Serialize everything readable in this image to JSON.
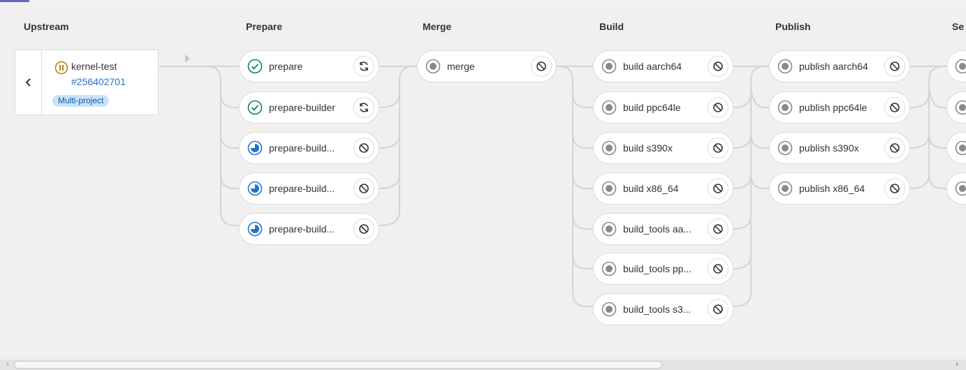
{
  "pipeline": {
    "stages": {
      "upstream": "Upstream",
      "prepare": "Prepare",
      "merge": "Merge",
      "build": "Build",
      "publish": "Publish",
      "next": "Se"
    },
    "upstream_card": {
      "project": "kernel-test",
      "pipeline_id": "#256402701",
      "badge": "Multi-project",
      "status": "paused"
    },
    "prepare_jobs": [
      {
        "name": "prepare",
        "status": "success",
        "action": "retry"
      },
      {
        "name": "prepare-builder",
        "status": "success",
        "action": "retry"
      },
      {
        "name": "prepare-build...",
        "status": "running",
        "action": "cancel"
      },
      {
        "name": "prepare-build...",
        "status": "running",
        "action": "cancel"
      },
      {
        "name": "prepare-build...",
        "status": "running",
        "action": "cancel"
      }
    ],
    "merge_jobs": [
      {
        "name": "merge",
        "status": "created",
        "action": "cancel"
      }
    ],
    "build_jobs": [
      {
        "name": "build aarch64",
        "status": "created",
        "action": "cancel"
      },
      {
        "name": "build ppc64le",
        "status": "created",
        "action": "cancel"
      },
      {
        "name": "build s390x",
        "status": "created",
        "action": "cancel"
      },
      {
        "name": "build x86_64",
        "status": "created",
        "action": "cancel"
      },
      {
        "name": "build_tools aa...",
        "status": "created",
        "action": "cancel"
      },
      {
        "name": "build_tools pp...",
        "status": "created",
        "action": "cancel"
      },
      {
        "name": "build_tools s3...",
        "status": "created",
        "action": "cancel"
      }
    ],
    "publish_jobs": [
      {
        "name": "publish aarch64",
        "status": "created",
        "action": "cancel"
      },
      {
        "name": "publish ppc64le",
        "status": "created",
        "action": "cancel"
      },
      {
        "name": "publish s390x",
        "status": "created",
        "action": "cancel"
      },
      {
        "name": "publish x86_64",
        "status": "created",
        "action": "cancel"
      }
    ]
  },
  "colors": {
    "success": "#108548",
    "running": "#1f75cb",
    "created": "#89888d",
    "paused": "#c17d10",
    "badge_bg": "#cbe2f9",
    "link": "#1f75cb"
  },
  "icons": {
    "success": "check-circle-icon",
    "running": "running-icon",
    "created": "created-icon",
    "paused": "pause-icon",
    "retry": "retry-icon",
    "cancel": "cancel-icon",
    "collapse": "chevron-left-icon",
    "arrow": "triangle-right-icon"
  }
}
